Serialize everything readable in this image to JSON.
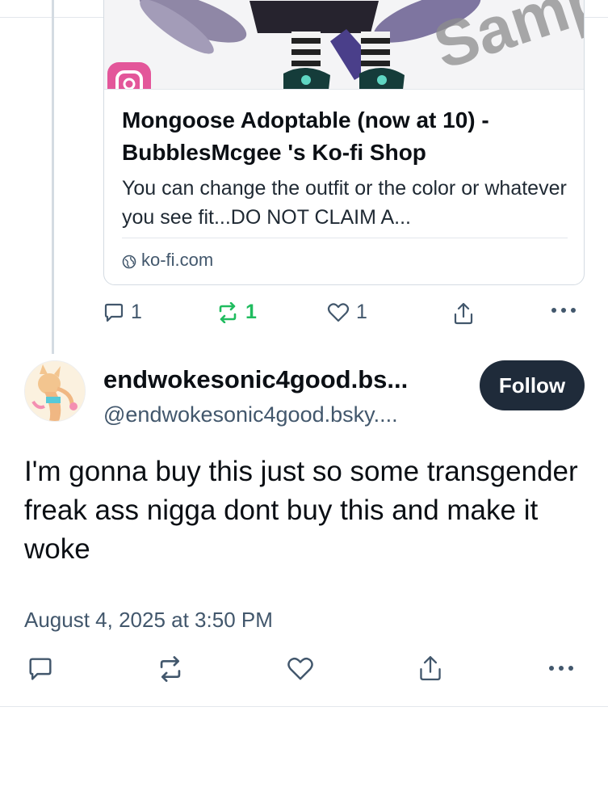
{
  "quoted_post": {
    "embed": {
      "title": "Mongoose Adoptable (now at 10) - BubblesMcgee 's Ko-fi Shop",
      "description": "You can change the outfit or the color or whatever you see fit...DO NOT CLAIM A...",
      "domain": "ko-fi.com",
      "thumbnail_watermark": "Sample"
    },
    "actions": {
      "reply_count": "1",
      "repost_count": "1",
      "like_count": "1"
    }
  },
  "post": {
    "display_name": "endwokesonic4good.bs...",
    "handle": "@endwokesonic4good.bsky....",
    "follow_label": "Follow",
    "text": "I'm gonna buy this just so some transgender freak ass nigga dont buy this and make it woke",
    "timestamp": "August 4, 2025 at 3:50 PM"
  },
  "colors": {
    "accent_dark": "#1f2b3a",
    "repost_active": "#20bc5f",
    "muted_text": "#42576c"
  },
  "icons": [
    "reply-icon",
    "repost-icon",
    "like-icon",
    "share-icon",
    "more-icon",
    "globe-icon"
  ]
}
